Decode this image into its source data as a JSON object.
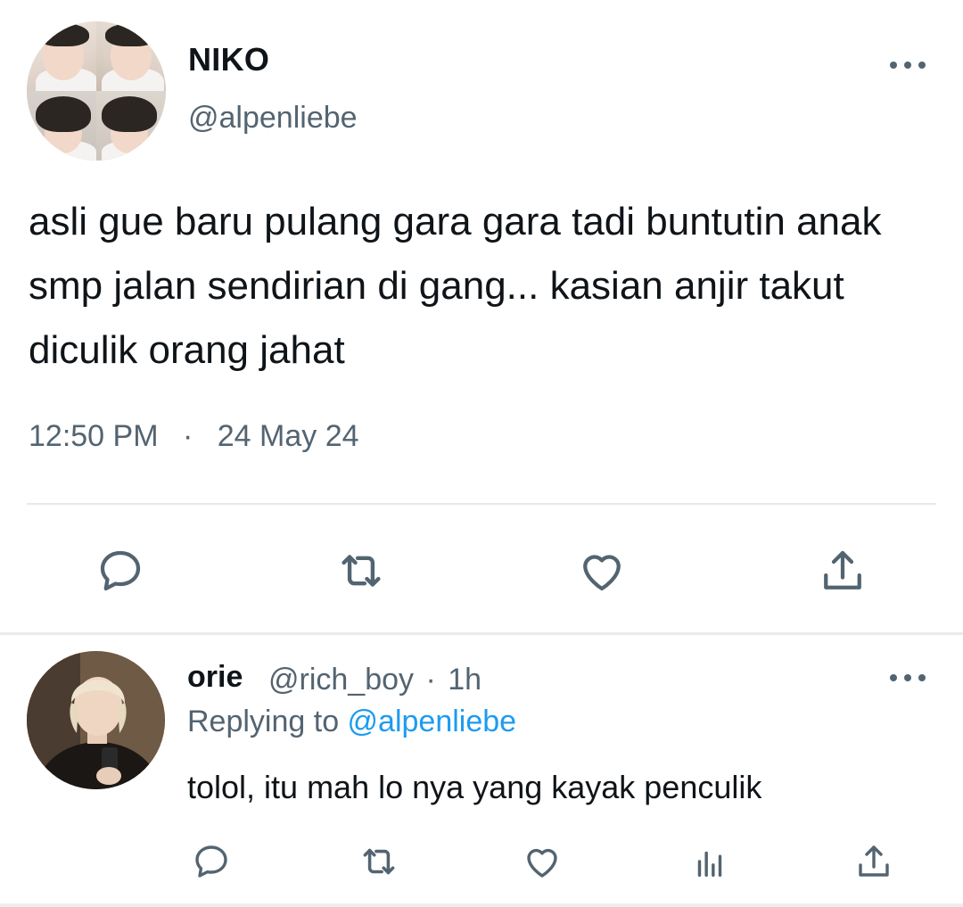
{
  "main_tweet": {
    "author_name": "NIKO",
    "author_handle": "@alpenliebe",
    "text": "asli gue baru pulang gara gara tadi buntutin anak smp jalan sendirian di gang... kasian anjir takut diculik orang jahat",
    "time": "12:50 PM",
    "separator": "·",
    "date": "24 May 24",
    "actions": [
      "reply-icon",
      "retweet-icon",
      "like-icon",
      "share-icon"
    ]
  },
  "reply_tweet": {
    "author_name": "orie",
    "author_handle": "@rich_boy",
    "meta_separator": "·",
    "age": "1h",
    "replying_prefix": "Replying to ",
    "replying_to": "@alpenliebe",
    "text": "tolol, itu mah lo nya yang kayak penculik",
    "actions": [
      "reply-icon",
      "retweet-icon",
      "like-icon",
      "analytics-icon",
      "share-icon"
    ]
  },
  "colors": {
    "text_primary": "#0f1419",
    "text_secondary": "#536471",
    "mention": "#1d9bf0",
    "divider": "#e6e9ea"
  }
}
